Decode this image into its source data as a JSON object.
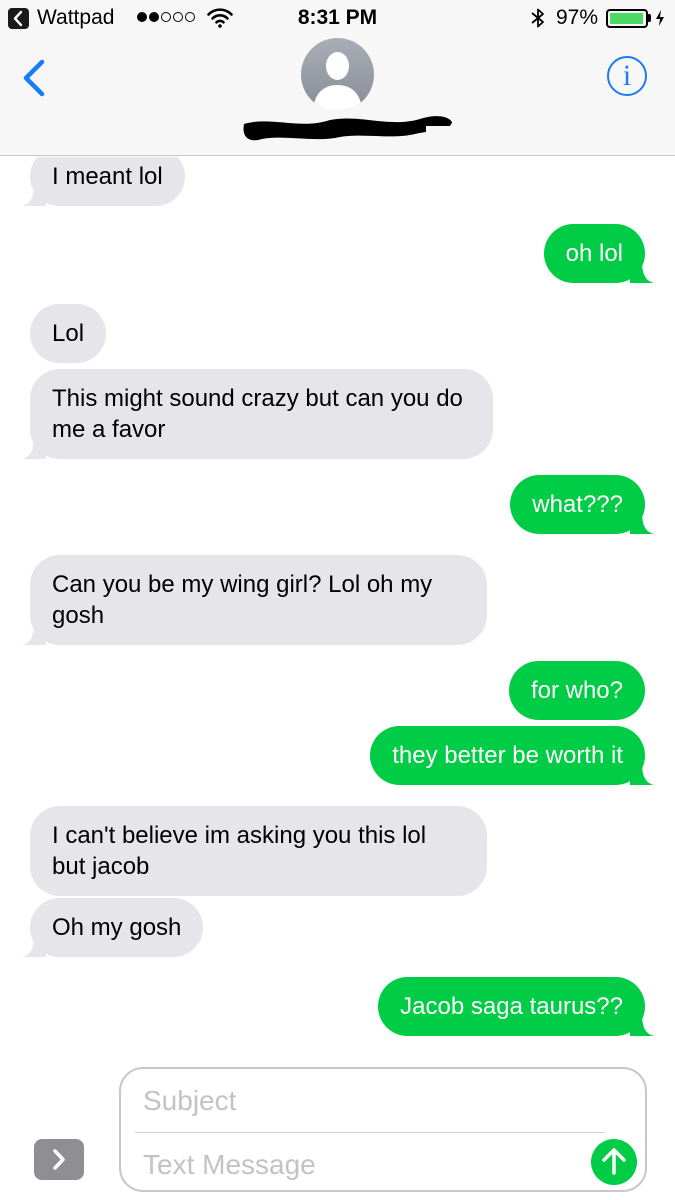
{
  "status_bar": {
    "back_app": "Wattpad",
    "time": "8:31 PM",
    "battery": "97%",
    "battery_level": 0.97,
    "signal_bars": 2,
    "signal_max": 5
  },
  "header": {
    "back_icon": "chevron-left-icon",
    "info_label": "i",
    "contact_name_redacted": true
  },
  "colors": {
    "incoming": "#e5e5ea",
    "outgoing": "#00cc45",
    "accent": "#1a7cf5"
  },
  "messages": [
    {
      "dir": "in",
      "text": "I meant lol"
    },
    {
      "dir": "out",
      "text": "oh lol"
    },
    {
      "dir": "in",
      "text": "Lol"
    },
    {
      "dir": "in",
      "text": "This might sound crazy but can you do me a favor"
    },
    {
      "dir": "out",
      "text": "what???"
    },
    {
      "dir": "in",
      "text": "Can you be my wing girl? Lol oh my gosh"
    },
    {
      "dir": "out",
      "text": "for who?"
    },
    {
      "dir": "out",
      "text": "they better be worth it"
    },
    {
      "dir": "in",
      "text": "I can't believe im asking you this lol but jacob"
    },
    {
      "dir": "in",
      "text": "Oh my gosh"
    },
    {
      "dir": "out",
      "text": "Jacob saga taurus??"
    }
  ],
  "composer": {
    "subject_placeholder": "Subject",
    "text_placeholder": "Text Message"
  }
}
